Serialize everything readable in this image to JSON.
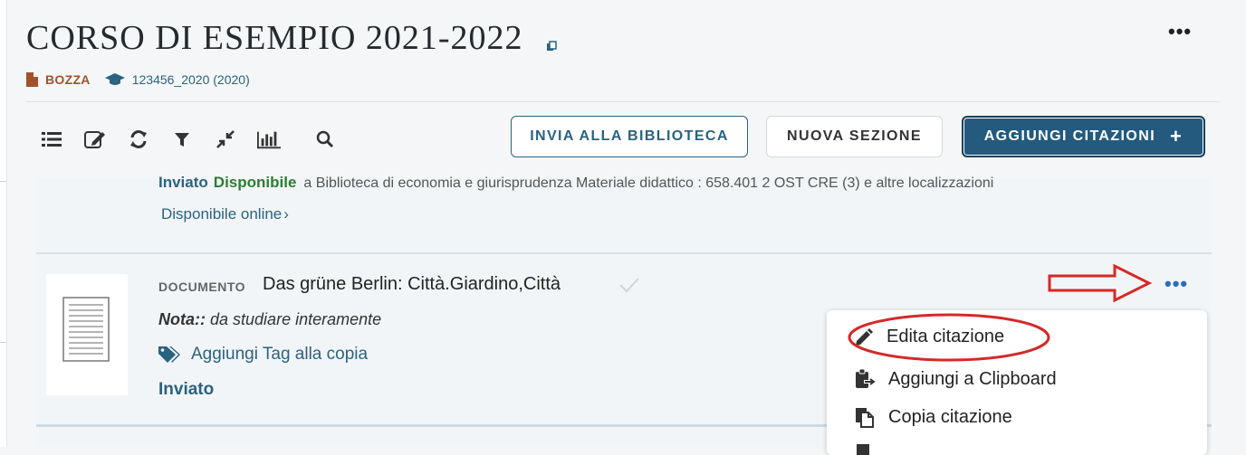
{
  "header": {
    "title": "CORSO DI ESEMPIO 2021-2022",
    "status_badge": "BOZZA",
    "course_code": "123456_2020 (2020)",
    "more_menu": "•••"
  },
  "toolbar": {
    "icons": [
      "list-icon",
      "edit-icon",
      "refresh-icon",
      "filter-icon",
      "collapse-icon",
      "stats-icon",
      "search-icon"
    ],
    "send_button": "INVIA ALLA BIBLIOTECA",
    "new_section_button": "NUOVA SEZIONE",
    "add_citations_button": "AGGIUNGI CITAZIONI",
    "add_citations_plus": "+"
  },
  "prev_item": {
    "status_sent": "Inviato",
    "status_available": "Disponibile",
    "location": "a Biblioteca di economia e giurisprudenza Materiale didattico : 658.401 2 OST CRE (3) e altre localizzazioni",
    "online_link": "Disponibile online",
    "online_chevron": "›"
  },
  "item": {
    "type": "DOCUMENTO",
    "title": "Das grüne Berlin: Città.Giardino,Città",
    "note_label": "Nota::",
    "note_text": "da studiare interamente",
    "tag_link": "Aggiungi Tag alla copia",
    "status": "Inviato",
    "more_menu": "•••"
  },
  "context_menu": {
    "items": [
      {
        "label": "Edita citazione",
        "icon": "pencil-icon"
      },
      {
        "label": "Aggiungi a Clipboard",
        "icon": "clipboard-icon"
      },
      {
        "label": "Copia citazione",
        "icon": "copy-icon"
      }
    ]
  },
  "colors": {
    "primary": "#235a7e",
    "link": "#2a6381",
    "available": "#2e7d32",
    "draft": "#a0522d",
    "annotation": "#d62828"
  }
}
